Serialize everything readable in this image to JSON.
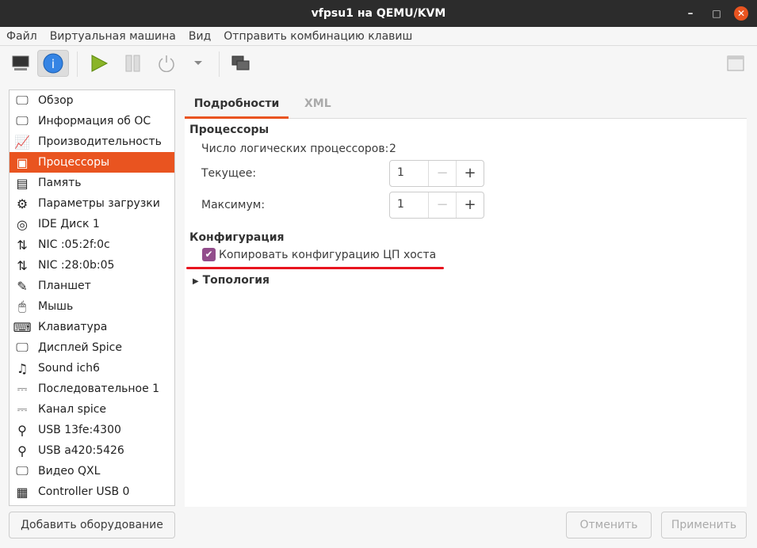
{
  "window": {
    "title": "vfpsu1 на QEMU/KVM",
    "minimize": "–",
    "maximize": "□",
    "close": "✕"
  },
  "menu": [
    "Файл",
    "Виртуальная машина",
    "Вид",
    "Отправить комбинацию клавиш"
  ],
  "toolbar": {
    "icons": [
      "monitor-icon",
      "info-icon",
      "play-icon",
      "pause-icon",
      "power-icon",
      "dropdown-icon",
      "screens-icon",
      "fullscreen-icon"
    ]
  },
  "sidebar": {
    "items": [
      {
        "label": "Обзор",
        "icon": "🖵"
      },
      {
        "label": "Информация об ОС",
        "icon": "🖵"
      },
      {
        "label": "Производительность",
        "icon": "📈"
      },
      {
        "label": "Процессоры",
        "icon": "▣"
      },
      {
        "label": "Память",
        "icon": "▤"
      },
      {
        "label": "Параметры загрузки",
        "icon": "⚙"
      },
      {
        "label": "IDE Диск 1",
        "icon": "◎"
      },
      {
        "label": "NIC :05:2f:0c",
        "icon": "⇅"
      },
      {
        "label": "NIC :28:0b:05",
        "icon": "⇅"
      },
      {
        "label": "Планшет",
        "icon": "✎"
      },
      {
        "label": "Мышь",
        "icon": "🖱"
      },
      {
        "label": "Клавиатура",
        "icon": "⌨"
      },
      {
        "label": "Дисплей Spice",
        "icon": "🖵"
      },
      {
        "label": "Sound ich6",
        "icon": "♫"
      },
      {
        "label": "Последовательное 1",
        "icon": "⎓"
      },
      {
        "label": "Канал spice",
        "icon": "⎓"
      },
      {
        "label": "USB 13fe:4300",
        "icon": "⚲"
      },
      {
        "label": "USB a420:5426",
        "icon": "⚲"
      },
      {
        "label": "Видео QXL",
        "icon": "🖵"
      },
      {
        "label": "Controller USB 0",
        "icon": "▦"
      }
    ],
    "selected": "Процессоры"
  },
  "tabs": [
    "Подробности",
    "XML"
  ],
  "cpu": {
    "section": "Процессоры",
    "logical_label": "Число логических процессоров:",
    "logical_value": "2",
    "current_label": "Текущее:",
    "current_value": "1",
    "max_label": "Максимум:",
    "max_value": "1",
    "minus": "−",
    "plus": "+"
  },
  "config": {
    "section": "Конфигурация",
    "copy_host": "Копировать конфигурацию ЦП хоста",
    "copy_host_checked": true
  },
  "topology": "Топология",
  "footer": {
    "add": "Добавить оборудование",
    "cancel": "Отменить",
    "apply": "Применить"
  },
  "colors": {
    "accent": "#e95420",
    "checkbox": "#924d8b",
    "annotation": "#e8141e"
  }
}
